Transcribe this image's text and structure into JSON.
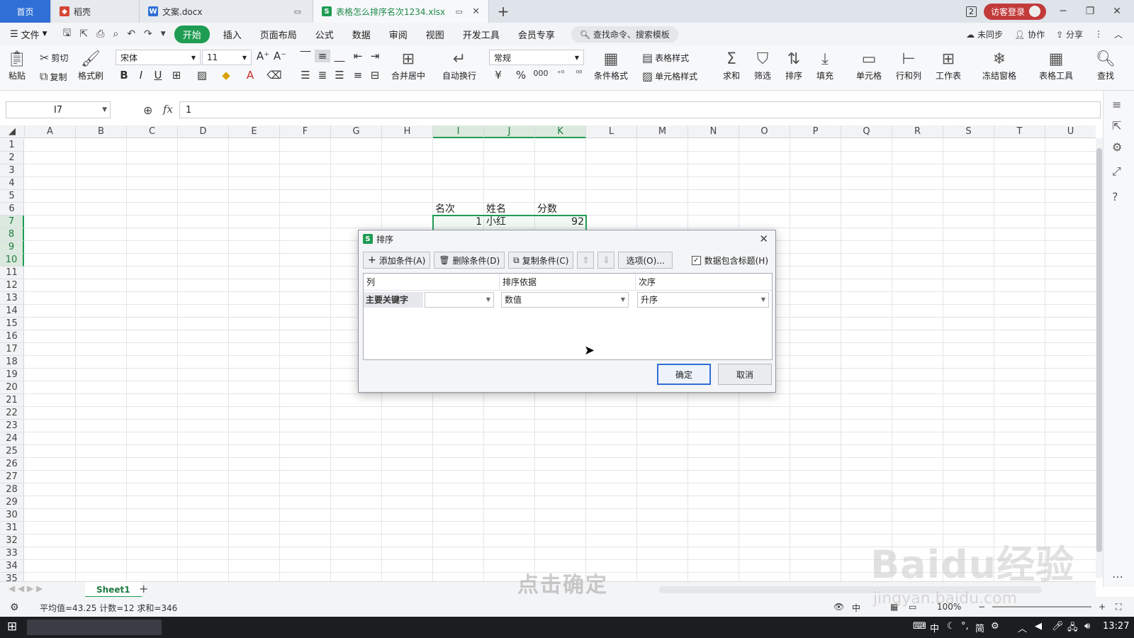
{
  "tabs": {
    "home": "首页",
    "daoke": "稻壳",
    "docx": "文案.docx",
    "active_file": "表格怎么排序名次1234.xlsx",
    "new_tab": "+"
  },
  "title_right": {
    "count_badge": "2",
    "login": "访客登录"
  },
  "menu": {
    "file": "文件",
    "items": [
      "开始",
      "插入",
      "页面布局",
      "公式",
      "数据",
      "审阅",
      "视图",
      "开发工具",
      "会员专享"
    ],
    "search": "查找命令、搜索模板",
    "sync": "未同步",
    "collab": "协作",
    "share": "分享"
  },
  "ribbon": {
    "paste": "粘贴",
    "cut": "剪切",
    "copy": "复制",
    "format_painter": "格式刷",
    "font_name": "宋体",
    "font_size": "11",
    "merge_center": "合并居中",
    "wrap_text": "自动换行",
    "number_format": "常规",
    "conditional_format": "条件格式",
    "table_style": "表格样式",
    "cell_style": "单元格样式",
    "sum": "求和",
    "filter": "筛选",
    "sort": "排序",
    "fill": "填充",
    "cell": "单元格",
    "row_col": "行和列",
    "worksheet": "工作表",
    "freeze": "冻结窗格",
    "table_tools": "表格工具",
    "find": "查找"
  },
  "formula_bar": {
    "name_box": "I7",
    "fx": "fx",
    "value": "1"
  },
  "columns": [
    "A",
    "B",
    "C",
    "D",
    "E",
    "F",
    "G",
    "H",
    "I",
    "J",
    "K",
    "L",
    "M",
    "N",
    "O",
    "P",
    "Q",
    "R",
    "S",
    "T",
    "U"
  ],
  "selected_columns": [
    "I",
    "J",
    "K"
  ],
  "rows": [
    "1",
    "2",
    "3",
    "4",
    "5",
    "6",
    "7",
    "8",
    "9",
    "10",
    "11",
    "12",
    "13",
    "14",
    "15",
    "16",
    "17",
    "18",
    "19",
    "20",
    "21",
    "22",
    "23",
    "24",
    "25",
    "26",
    "27",
    "28",
    "29",
    "30",
    "31",
    "32",
    "33",
    "34",
    "35"
  ],
  "selected_rows": [
    "7",
    "8",
    "9",
    "10"
  ],
  "sheet_cells": {
    "i6": "名次",
    "j6": "姓名",
    "k6": "分数",
    "i7": "1",
    "j7": "小红",
    "k7": "92"
  },
  "sort_dialog": {
    "title": "排序",
    "add_condition": "添加条件(A)",
    "delete_condition": "删除条件(D)",
    "copy_condition": "复制条件(C)",
    "options": "选项(O)...",
    "header_checkbox": "数据包含标题(H)",
    "header_checked": true,
    "col_header": "列",
    "basis_header": "排序依据",
    "order_header": "次序",
    "primary_key": "主要关键字",
    "primary_key_value": "",
    "basis_value": "数值",
    "order_value": "升序",
    "ok": "确定",
    "cancel": "取消"
  },
  "sheet_tabs": {
    "sheet1": "Sheet1"
  },
  "status": {
    "summary": "平均值=43.25  计数=12  求和=346",
    "zoom": "100%"
  },
  "taskbar": {
    "ime": "中",
    "lang": "简",
    "time": "13:27"
  },
  "overlay": {
    "caption": "点击确定",
    "watermark": "Baidu经验",
    "watermark_url": "jingyan.baidu.com"
  }
}
